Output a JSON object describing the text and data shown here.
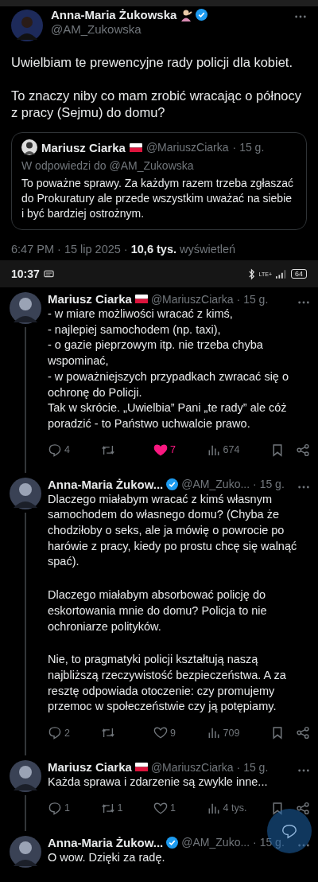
{
  "main_tweet": {
    "name": "Anna-Maria Żukowska",
    "handle": "@AM_Zukowska",
    "verified": true,
    "text": [
      "Uwielbiam te prewencyjne rady policji dla kobiet.",
      "To znaczy niby co mam zrobić wracając o północy z pracy (Sejmu) do domu?"
    ],
    "quote": {
      "name": "Mariusz Ciarka",
      "flag": true,
      "handle": "@MariuszCiarka",
      "time": "· 15 g.",
      "reply_to": "W odpowiedzi do @AM_Zukowska",
      "text": "To poważne sprawy. Za każdym razem trzeba zgłaszać do Prokuratury ale przede wszystkim uważać na siebie i być bardziej ostrożnym."
    },
    "meta": "6:47 PM · 15 lip 2025 · **10,6 tys.** wyświetleń"
  },
  "status_bar": {
    "time": "10:37",
    "network": "LTE+",
    "battery": "64"
  },
  "replies": [
    {
      "name": "Mariusz Ciarka",
      "flag": true,
      "handle": "@MariuszCiarka",
      "time": "· 15 g.",
      "text": [
        "- w miare możliwości wracać z kimś,\n- najlepiej samochodem (np. taxi),\n- o gazie pieprzowym itp. nie trzeba chyba wspominać,\n- w poważniejszych przypadkach zwracać się o ochronę do Policji.\nTak w skrócie. „Uwielbia” Pani „te rady” ale cóż poradzić - to Państwo uchwalcie prawo."
      ],
      "actions": {
        "replies": "4",
        "likes": "7",
        "liked": true,
        "views": "674"
      }
    },
    {
      "name": "Anna-Maria Żukow...",
      "verified": true,
      "handle": "@AM_Zuko...",
      "time": "· 15 g.",
      "text": [
        "Dlaczego miałabym wracać z kimś własnym samochodem do własnego domu? (Chyba że chodziłoby o seks, ale ja mówię o powrocie po harówie z pracy, kiedy po prostu chcę się walnąć spać).",
        "Dlaczego miałabym absorbować policję do eskortowania mnie do domu? Policja to nie ochroniarze polityków.",
        "Nie, to pragmatyki policji kształtują naszą najbliższą rzeczywistość bezpieczeństwa. A za resztę odpowiada otoczenie: czy promujemy przemoc w społeczeństwie czy ją potępiamy."
      ],
      "actions": {
        "replies": "2",
        "likes": "9",
        "liked": false,
        "views": "709"
      }
    },
    {
      "name": "Mariusz Ciarka",
      "flag": true,
      "handle": "@MariuszCiarka",
      "time": "· 15 g.",
      "text": [
        "Każda sprawa i zdarzenie są zwykle inne..."
      ],
      "actions": {
        "replies": "1",
        "reposts": "1",
        "likes": "1",
        "liked": false,
        "views": "4 tys."
      }
    },
    {
      "name": "Anna-Maria Żukow...",
      "verified": true,
      "handle": "@AM_Zuko...",
      "time": "· 15 g.",
      "text": [
        "O wow. Dzięki za radę."
      ]
    }
  ]
}
